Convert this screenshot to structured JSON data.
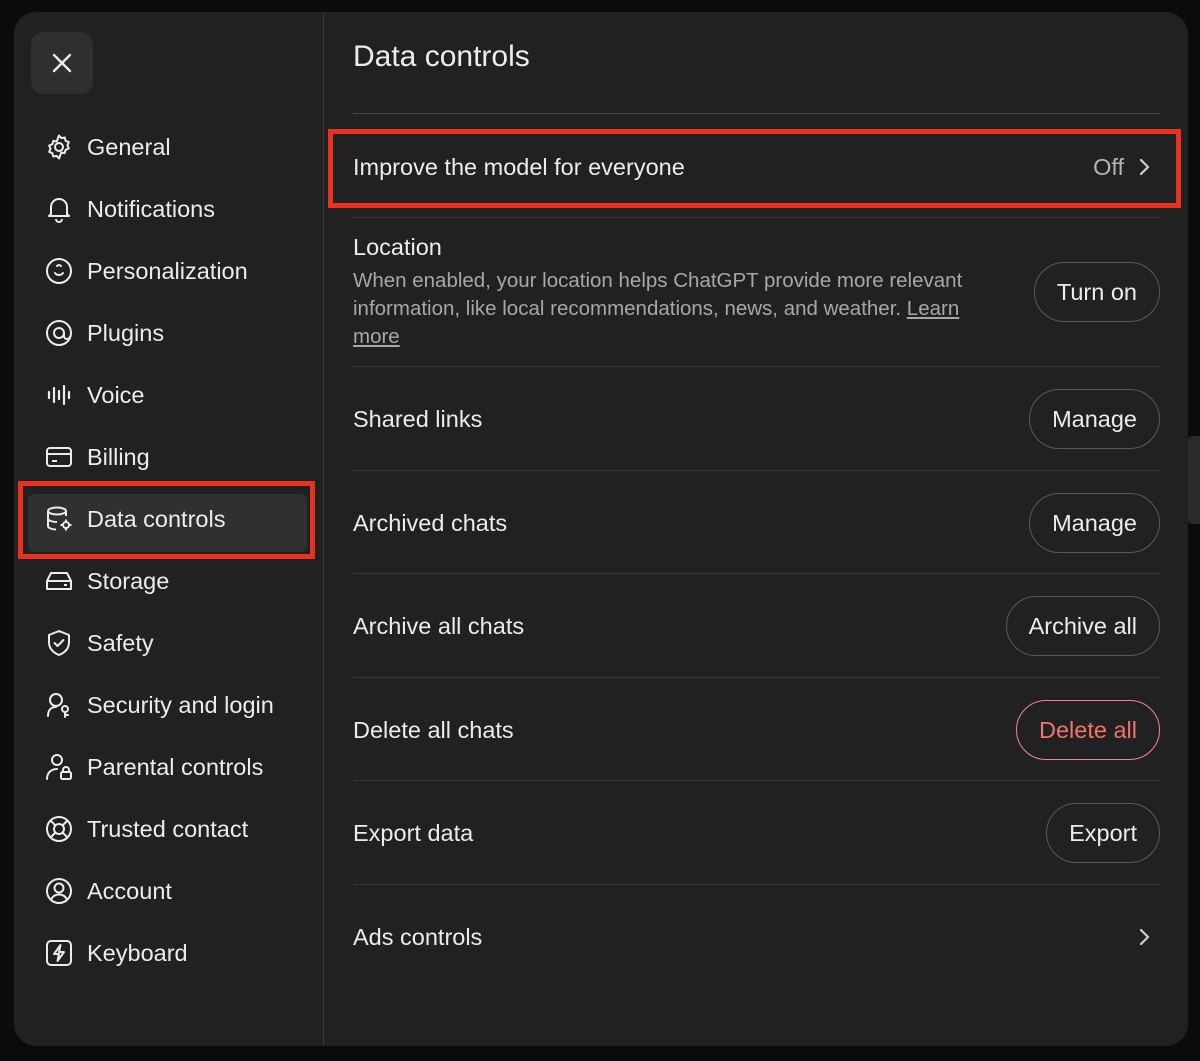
{
  "sidebar": {
    "items": [
      {
        "label": "General",
        "icon": "gear-icon"
      },
      {
        "label": "Notifications",
        "icon": "bell-icon"
      },
      {
        "label": "Personalization",
        "icon": "personalization-icon"
      },
      {
        "label": "Plugins",
        "icon": "plugins-icon"
      },
      {
        "label": "Voice",
        "icon": "waveform-icon"
      },
      {
        "label": "Billing",
        "icon": "credit-card-icon"
      },
      {
        "label": "Data controls",
        "icon": "database-gear-icon"
      },
      {
        "label": "Storage",
        "icon": "storage-drive-icon"
      },
      {
        "label": "Safety",
        "icon": "shield-check-icon"
      },
      {
        "label": "Security and login",
        "icon": "security-person-icon"
      },
      {
        "label": "Parental controls",
        "icon": "person-lock-icon"
      },
      {
        "label": "Trusted contact",
        "icon": "lifebuoy-icon"
      },
      {
        "label": "Account",
        "icon": "user-circle-icon"
      },
      {
        "label": "Keyboard",
        "icon": "keyboard-bolt-icon"
      }
    ],
    "active": "Data controls"
  },
  "main": {
    "title": "Data controls",
    "improve": {
      "label": "Improve the model for everyone",
      "value": "Off"
    },
    "location": {
      "label": "Location",
      "description": "When enabled, your location helps ChatGPT provide more relevant information, like local recommendations, news, and weather.",
      "link": "Learn more",
      "button": "Turn on"
    },
    "shared_links": {
      "label": "Shared links",
      "button": "Manage"
    },
    "archived_chats": {
      "label": "Archived chats",
      "button": "Manage"
    },
    "archive_all": {
      "label": "Archive all chats",
      "button": "Archive all"
    },
    "delete_all": {
      "label": "Delete all chats",
      "button": "Delete all"
    },
    "export": {
      "label": "Export data",
      "button": "Export"
    },
    "ads": {
      "label": "Ads controls"
    }
  },
  "colors": {
    "highlight": "#e8321f",
    "danger": "#f1736c",
    "background": "#212121"
  }
}
